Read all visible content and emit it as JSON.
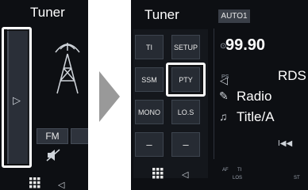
{
  "left_screen": {
    "title": "Tuner",
    "band_label": "FM",
    "arrow_glyph": "▷",
    "back_glyph": "◁",
    "icons": [
      "antenna-tower-icon",
      "mute-icon",
      "grid-menu-icon",
      "back-icon"
    ]
  },
  "right_screen": {
    "title": "Tuner",
    "auto_label": "AUTO1",
    "buttons": {
      "ti": "TI",
      "setup": "SETUP",
      "ssm": "SSM",
      "pty": "PTY",
      "mono": "MONO",
      "los": "LO.S",
      "minus1": "–",
      "minus2": "–"
    },
    "collapse_glyph": "◁",
    "back_glyph": "◁",
    "frequency": "99.90",
    "ps_label": "PS",
    "ps_value": "RDS",
    "radio_text": "Radio",
    "title_text": "Title/A",
    "prev_glyph": "I◀◀",
    "status": {
      "af": "AF",
      "ti": "TI",
      "los": "LOS",
      "st": "ST"
    }
  },
  "colors": {
    "screen_bg": "#0d0f13",
    "button_bg": "#262b33",
    "highlight": "#ffffff"
  }
}
